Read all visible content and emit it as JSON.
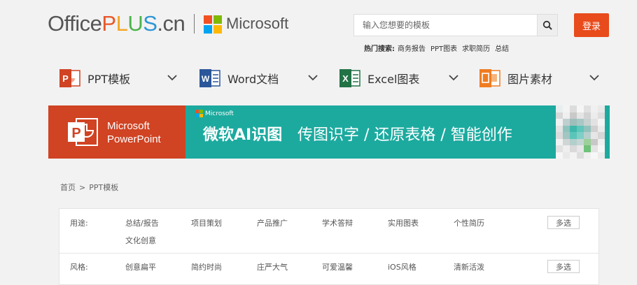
{
  "header": {
    "logo": {
      "part1": "Office",
      "plus_p": "P",
      "plus_l": "L",
      "plus_u": "U",
      "plus_s": "S",
      "part3": ".cn"
    },
    "partner": "Microsoft",
    "search": {
      "placeholder": "输入您想要的模板"
    },
    "login_label": "登录",
    "hot_label": "热门搜索:",
    "hot_items": [
      "商务报告",
      "PPT图表",
      "求职简历",
      "总结"
    ]
  },
  "nav": {
    "items": [
      {
        "label": "PPT模板",
        "icon": "powerpoint-icon",
        "color": "#d04323"
      },
      {
        "label": "Word文档",
        "icon": "word-icon",
        "color": "#2b579a"
      },
      {
        "label": "Excel图表",
        "icon": "excel-icon",
        "color": "#217346"
      },
      {
        "label": "图片素材",
        "icon": "image-material-icon",
        "color": "#ef7d22"
      }
    ]
  },
  "banner": {
    "product_brand": "Microsoft",
    "product_name": "PowerPoint",
    "partner_tag": "Microsoft",
    "title": "微软AI识图",
    "subtitle": "传图识字 / 还原表格 / 智能创作",
    "colors": {
      "left": "#d04323",
      "main": "#1caa9f"
    }
  },
  "breadcrumb": {
    "home": "首页",
    "sep": ">",
    "current": "PPT模板"
  },
  "filters": {
    "multi_label": "多选",
    "rows": [
      {
        "label": "用途:",
        "options": [
          "总结/报告",
          "项目策划",
          "产品推广",
          "学术答辩",
          "实用图表",
          "个性简历",
          "文化创意"
        ]
      },
      {
        "label": "风格:",
        "options": [
          "创意扁平",
          "简约时尚",
          "庄严大气",
          "可爱温馨",
          "iOS风格",
          "清新活泼"
        ]
      }
    ]
  }
}
